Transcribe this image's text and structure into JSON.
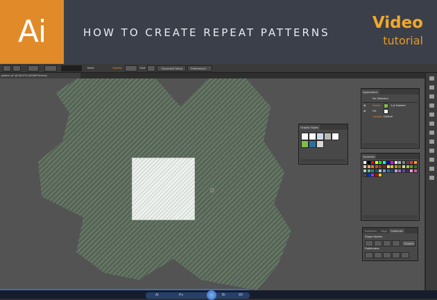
{
  "banner": {
    "logo": "Ai",
    "title": "HOW TO CREATE REPEAT PATTERNS",
    "video_label": "Video",
    "tutorial_label": "tutorial"
  },
  "control_bar": {
    "items": [
      "Basic",
      "Opacity",
      "Style",
      "Document Setup",
      "Preferences"
    ]
  },
  "document": {
    "tab_label": "pattern.ai* @ 66.67% (RGB/Preview)"
  },
  "appearance_panel": {
    "tab": "Appearance",
    "selection": "No Selection",
    "rows": [
      {
        "label": "Stroke:",
        "value": "1 pt Dashed"
      },
      {
        "label": "Fill:",
        "value": ""
      },
      {
        "label": "Opacity:",
        "value": "Default"
      }
    ]
  },
  "graphic_styles_panel": {
    "tab": "Graphic Styles",
    "style_colors": [
      "#ffffff",
      "#ffffff",
      "#cfd8e6",
      "#b9b9b9",
      "#ffffff",
      "#7fbf4a",
      "#2a6fa0",
      "#d7d7d7"
    ]
  },
  "swatches_panel": {
    "tab": "Swatches",
    "colors": [
      "#ffffff",
      "#000000",
      "#ff0000",
      "#ffff00",
      "#00ff00",
      "#00ffff",
      "#0000ff",
      "#ff00ff",
      "#e6e6e6",
      "#b3b3b3",
      "#808080",
      "#4d4d4d",
      "#ff3333",
      "#ff9933",
      "#f7c99e",
      "#f3a36a",
      "#e07a3b",
      "#c2562a",
      "#9f3b1f",
      "#7b2c17",
      "#f2e26b",
      "#d8c34a",
      "#b29a2b",
      "#8b7520",
      "#cde29a",
      "#9fc25e",
      "#6c9a33",
      "#436b22",
      "#9fd6c7",
      "#5fb0a0",
      "#2f8577",
      "#1d5c54",
      "#a6c8ea",
      "#6e9ed3",
      "#3b6fb6",
      "#254b86",
      "#b9a6d6",
      "#8f73b9",
      "#65459a",
      "#432c6f",
      "#e7a6c8",
      "#c9649b",
      "#3d4a5c",
      "#0033cc",
      "#9933ff",
      "#cc0000",
      "#ffcc00"
    ]
  },
  "pathfinder_panel": {
    "tabs": [
      "Transform",
      "Align",
      "Pathfinder"
    ],
    "shape_modes_label": "Shape Modes:",
    "pathfinders_label": "Pathfinders:",
    "expand_label": "Expand"
  },
  "taskbar": {
    "items": [
      "Ai",
      "Ps",
      "Br",
      "Wi"
    ]
  },
  "colors": {
    "banner_bg": "#3b3f4a",
    "logo_orange": "#e08a2a",
    "video_orange": "#f0a92b",
    "canvas_gray": "#535353",
    "pattern_green": "#7c9e82"
  }
}
